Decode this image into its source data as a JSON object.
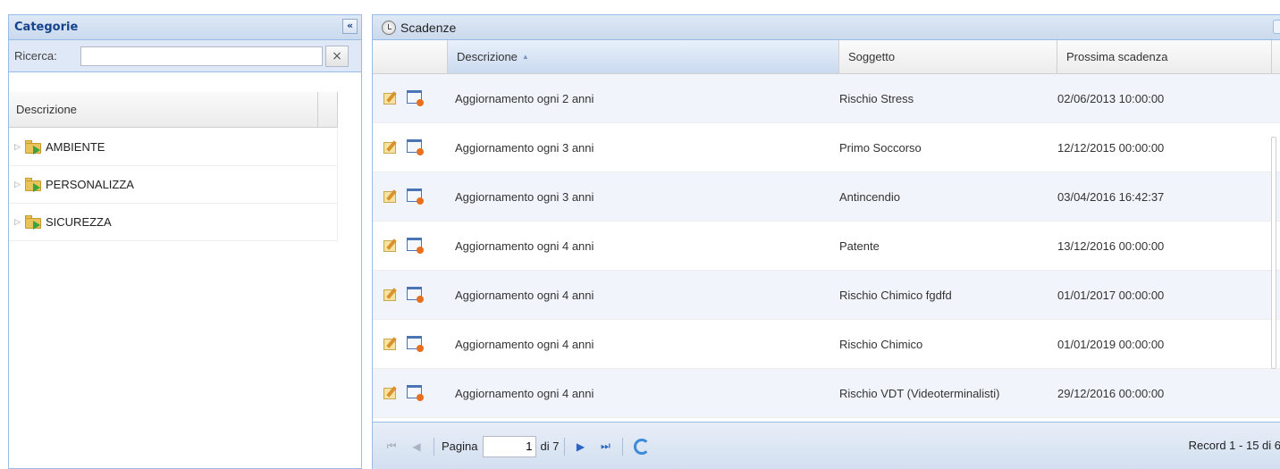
{
  "categorie": {
    "title": "Categorie",
    "collapse_icon": "«",
    "search_label": "Ricerca:",
    "search_value": "",
    "clear_icon": "×",
    "tree_column": "Descrizione",
    "items": [
      {
        "label": "AMBIENTE"
      },
      {
        "label": "PERSONALIZZA"
      },
      {
        "label": "SICUREZZA"
      }
    ]
  },
  "scadenze": {
    "title": "Scadenze",
    "columns": {
      "descrizione": "Descrizione",
      "soggetto": "Soggetto",
      "prossima": "Prossima scadenza"
    },
    "sort_indicator": "▲",
    "rows": [
      {
        "descrizione": "Aggiornamento ogni 2 anni",
        "soggetto": "Rischio Stress",
        "prossima": "02/06/2013 10:00:00"
      },
      {
        "descrizione": "Aggiornamento ogni 3 anni",
        "soggetto": "Primo Soccorso",
        "prossima": "12/12/2015 00:00:00"
      },
      {
        "descrizione": "Aggiornamento ogni 3 anni",
        "soggetto": "Antincendio",
        "prossima": "03/04/2016 16:42:37"
      },
      {
        "descrizione": "Aggiornamento ogni 4 anni",
        "soggetto": "Patente",
        "prossima": "13/12/2016 00:00:00"
      },
      {
        "descrizione": "Aggiornamento ogni 4 anni",
        "soggetto": "Rischio Chimico fgdfd",
        "prossima": "01/01/2017 00:00:00"
      },
      {
        "descrizione": "Aggiornamento ogni 4 anni",
        "soggetto": "Rischio Chimico",
        "prossima": "01/01/2019 00:00:00"
      },
      {
        "descrizione": "Aggiornamento ogni 4 anni",
        "soggetto": "Rischio VDT (Videoterminalisti)",
        "prossima": "29/12/2016 00:00:00"
      }
    ],
    "paging": {
      "page_label": "Pagina",
      "page_value": "1",
      "of_label": "di 7",
      "record_info": "Record 1 - 15 di 6"
    }
  },
  "icons": {
    "first": "⏮",
    "prev": "◀",
    "next": "▶",
    "last": "⏭"
  }
}
